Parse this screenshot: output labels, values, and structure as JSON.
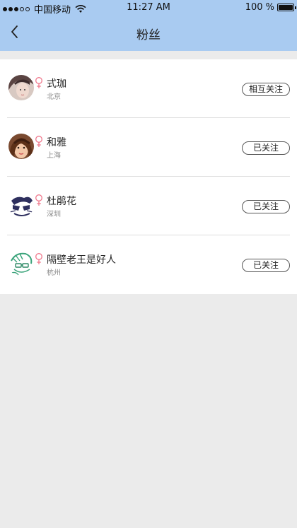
{
  "status_bar": {
    "carrier": "中国移动",
    "time": "11:27 AM",
    "battery": "100 %",
    "signal_bars_filled": 3,
    "signal_bars_total": 5
  },
  "nav": {
    "title": "粉丝",
    "back_icon": "chevron-left-icon"
  },
  "colors": {
    "nav_background": "#a9cbf1",
    "gender_female": "#f0788c",
    "page_background": "#ebebeb"
  },
  "fans": [
    {
      "name": "式珈",
      "city": "北京",
      "gender": "female",
      "button": "相互关注"
    },
    {
      "name": "和雅",
      "city": "上海",
      "gender": "female",
      "button": "已关注"
    },
    {
      "name": "杜鹃花",
      "city": "深圳",
      "gender": "female",
      "button": "已关注"
    },
    {
      "name": "隔壁老王是好人",
      "city": "杭州",
      "gender": "female",
      "button": "已关注"
    }
  ]
}
